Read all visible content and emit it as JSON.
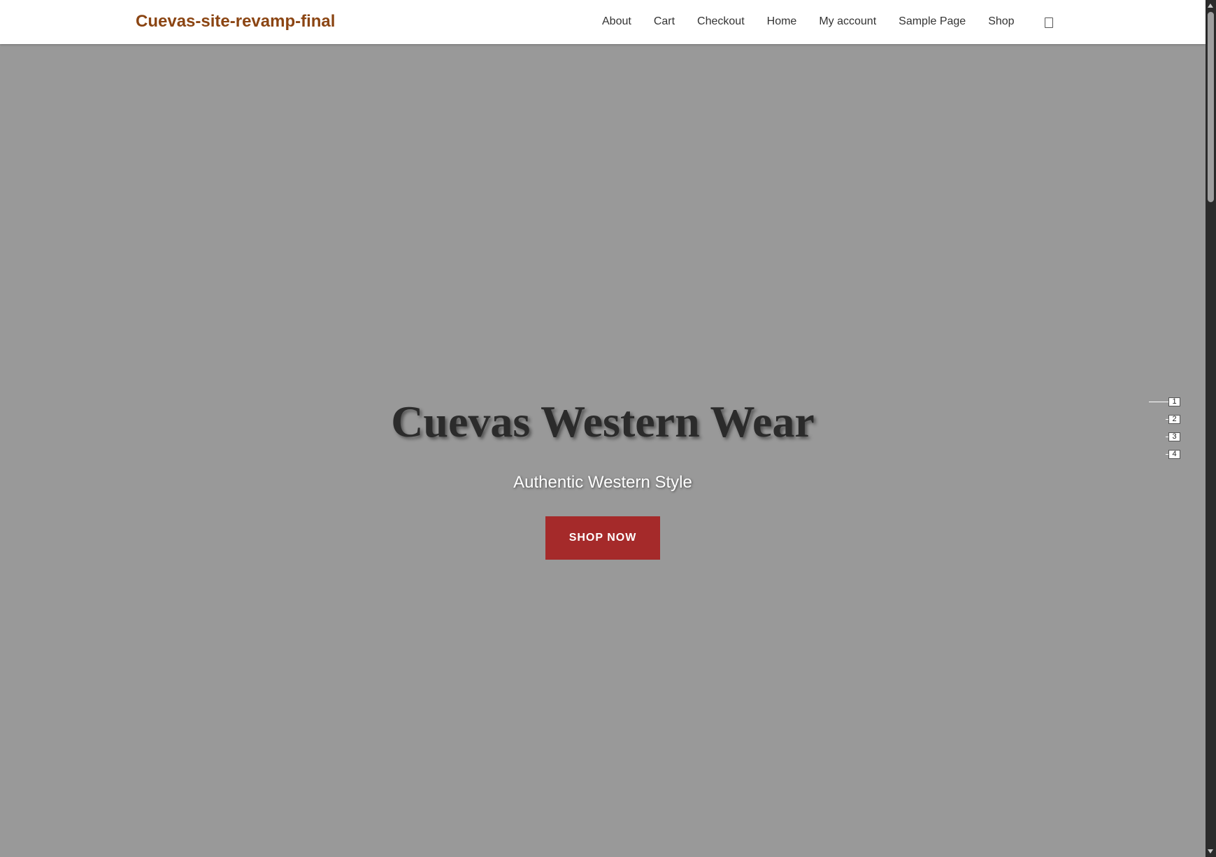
{
  "header": {
    "site_title": "Cuevas-site-revamp-final",
    "nav": [
      {
        "label": "About"
      },
      {
        "label": "Cart"
      },
      {
        "label": "Checkout"
      },
      {
        "label": "Home"
      },
      {
        "label": "My account"
      },
      {
        "label": "Sample Page"
      },
      {
        "label": "Shop"
      }
    ],
    "cart_icon": "cart-icon"
  },
  "hero": {
    "title": "Cuevas Western Wear",
    "subtitle": "Authentic Western Style",
    "button_label": "SHOP NOW"
  },
  "slider": {
    "slides": [
      "1",
      "2",
      "3",
      "4"
    ],
    "active_index": 0
  },
  "colors": {
    "brand": "#8b4513",
    "hero_bg": "#999999",
    "button_bg": "#a52a2a",
    "header_bg": "#ffffff"
  }
}
